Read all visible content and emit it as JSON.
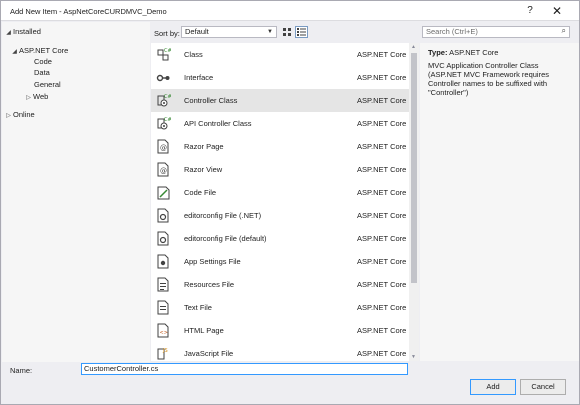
{
  "dialog": {
    "title": "Add New Item - AspNetCoreCURDMVC_Demo",
    "help": "?",
    "close": "✕"
  },
  "tree": {
    "installed": "Installed",
    "aspnet_core": "ASP.NET Core",
    "code": "Code",
    "data": "Data",
    "general": "General",
    "web": "Web",
    "online": "Online"
  },
  "toolbar": {
    "sort_label": "Sort by:",
    "sort_value": "Default",
    "search_placeholder": "Search (Ctrl+E)"
  },
  "items": [
    {
      "name": "Class",
      "category": "ASP.NET Core",
      "icon": "class-icon"
    },
    {
      "name": "Interface",
      "category": "ASP.NET Core",
      "icon": "interface-icon"
    },
    {
      "name": "Controller Class",
      "category": "ASP.NET Core",
      "icon": "controller-icon"
    },
    {
      "name": "API Controller Class",
      "category": "ASP.NET Core",
      "icon": "api-controller-icon"
    },
    {
      "name": "Razor Page",
      "category": "ASP.NET Core",
      "icon": "razor-page-icon"
    },
    {
      "name": "Razor View",
      "category": "ASP.NET Core",
      "icon": "razor-view-icon"
    },
    {
      "name": "Code File",
      "category": "ASP.NET Core",
      "icon": "code-file-icon"
    },
    {
      "name": "editorconfig File (.NET)",
      "category": "ASP.NET Core",
      "icon": "editorconfig-icon"
    },
    {
      "name": "editorconfig File (default)",
      "category": "ASP.NET Core",
      "icon": "editorconfig-icon"
    },
    {
      "name": "App Settings File",
      "category": "ASP.NET Core",
      "icon": "settings-file-icon"
    },
    {
      "name": "Resources File",
      "category": "ASP.NET Core",
      "icon": "resources-file-icon"
    },
    {
      "name": "Text File",
      "category": "ASP.NET Core",
      "icon": "text-file-icon"
    },
    {
      "name": "HTML Page",
      "category": "ASP.NET Core",
      "icon": "html-page-icon"
    },
    {
      "name": "JavaScript File",
      "category": "ASP.NET Core",
      "icon": "javascript-file-icon"
    }
  ],
  "selected_index": 2,
  "info": {
    "type_label": "Type:",
    "type_value": "ASP.NET Core",
    "description": "MVC Application Controller Class (ASP.NET MVC Framework requires Controller names to be suffixed with \"Controller\")"
  },
  "footer": {
    "name_label": "Name:",
    "name_value": "CustomerController.cs",
    "add_label": "Add",
    "cancel_label": "Cancel"
  },
  "colors": {
    "selection": "#cce4f7",
    "focus_border": "#3399ff",
    "csharp_green": "#388a34",
    "icon_dark": "#424242"
  }
}
